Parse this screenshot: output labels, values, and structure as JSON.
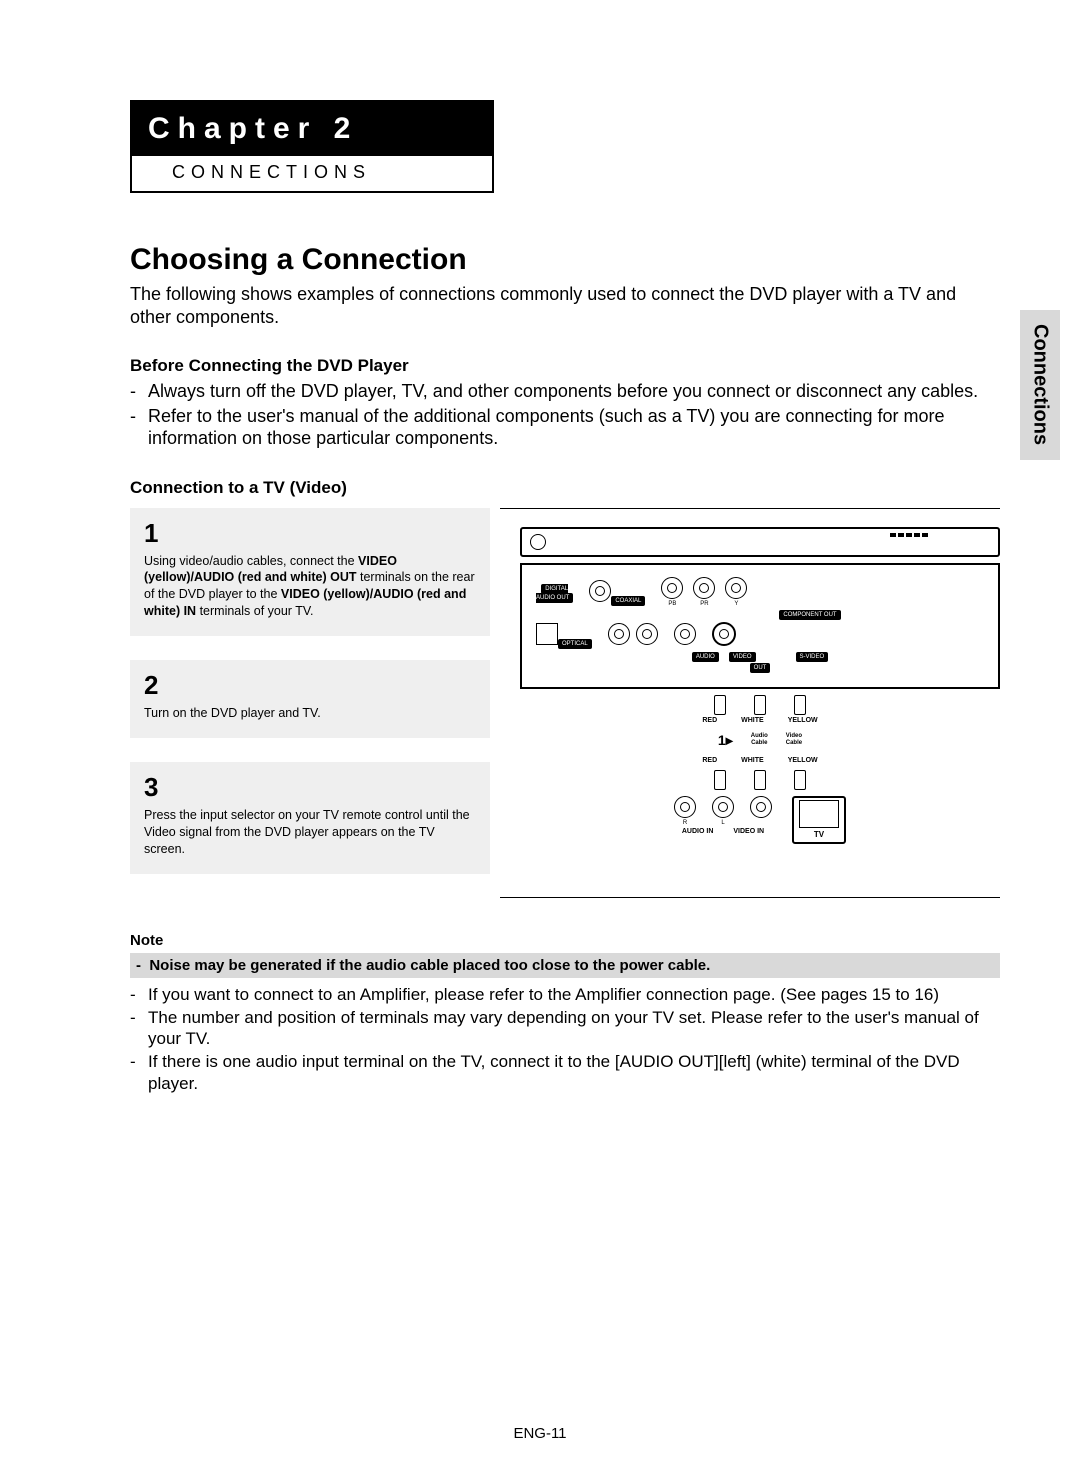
{
  "chapter": {
    "label": "Chapter 2",
    "subtitle": "CONNECTIONS"
  },
  "tab": {
    "label": "Connections"
  },
  "section": {
    "title": "Choosing a Connection",
    "intro": "The following shows examples of connections commonly used to connect the DVD player with a TV and other components."
  },
  "before": {
    "heading": "Before Connecting the DVD Player",
    "items": [
      "Always turn off the DVD player, TV, and other components before you connect or disconnect any cables.",
      "Refer to the user's manual of the additional components (such as a TV) you are connecting for more information on those particular components."
    ]
  },
  "tvconn": {
    "heading": "Connection to a TV (Video)"
  },
  "steps": [
    {
      "num": "1",
      "pre": "Using video/audio cables, connect the ",
      "b1": "VIDEO (yellow)/AUDIO (red and white) OUT",
      "mid": " terminals on the rear of the DVD player to the ",
      "b2": "VIDEO (yellow)/AUDIO (red and white) IN",
      "post": " terminals of your TV."
    },
    {
      "num": "2",
      "text": "Turn on the DVD player and TV."
    },
    {
      "num": "3",
      "text": "Press the input selector on your TV remote control until the Video signal from the DVD player appears on the TV screen."
    }
  ],
  "diagram": {
    "labels": {
      "digital": "DIGITAL\nAUDIO OUT",
      "coaxial": "COAXIAL",
      "component": "COMPONENT OUT",
      "optical": "OPTICAL",
      "audio": "AUDIO",
      "video": "VIDEO",
      "out": "OUT",
      "svideo": "S-VIDEO",
      "red": "RED",
      "white": "WHITE",
      "yellow": "YELLOW",
      "audio_cable": "Audio\nCable",
      "video_cable": "Video\nCable",
      "step1": "1▸",
      "r": "R",
      "l": "L",
      "audio_in": "AUDIO IN",
      "video_in": "VIDEO IN",
      "tv": "TV",
      "pb": "PB",
      "pr": "PR",
      "y": "Y"
    }
  },
  "note": {
    "heading": "Note",
    "highlight": "Noise may be generated if the audio cable placed too close to the power cable.",
    "items": [
      "If you want to connect to an Amplifier, please refer to the Amplifier connection page. (See pages 15 to 16)",
      "The number and position of terminals may vary depending on your TV set. Please refer to the user's manual of your TV.",
      "If there is one audio input terminal on the TV, connect it to the [AUDIO OUT][left] (white) terminal of the DVD player."
    ]
  },
  "footer": {
    "page": "ENG-11"
  }
}
